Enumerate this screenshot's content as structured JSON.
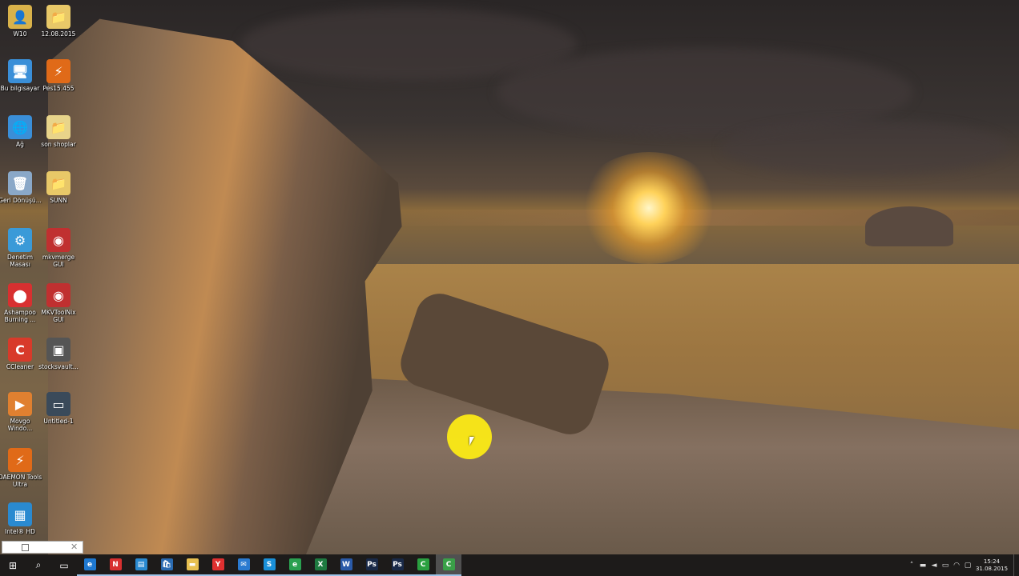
{
  "desktop": {
    "icons": [
      {
        "id": "w10",
        "label": "W10",
        "icon": "user-folder-icon",
        "color": "#d9b24a",
        "glyph": "👤"
      },
      {
        "id": "date-folder",
        "label": "12.08.2015",
        "icon": "folder-icon",
        "color": "#e8c868",
        "glyph": "📁"
      },
      {
        "id": "this-pc",
        "label": "Bu bilgisayar",
        "icon": "computer-icon",
        "color": "#3a8fd8",
        "glyph": "🖥"
      },
      {
        "id": "pes",
        "label": "Pes15.455",
        "icon": "pes-app-icon",
        "color": "#e06a18",
        "glyph": "⚡"
      },
      {
        "id": "network",
        "label": "Ağ",
        "icon": "network-icon",
        "color": "#3a8fd8",
        "glyph": "🌐"
      },
      {
        "id": "son-shoplar",
        "label": "son shoplar",
        "icon": "folder-icon",
        "color": "#e8d48a",
        "glyph": "📁"
      },
      {
        "id": "recycle-bin",
        "label": "Geri Dönüşü...",
        "icon": "recycle-bin-icon",
        "color": "#8aa8c8",
        "glyph": "🗑"
      },
      {
        "id": "sunn",
        "label": "SUNN",
        "icon": "folder-icon",
        "color": "#e8c868",
        "glyph": "📁"
      },
      {
        "id": "control-panel",
        "label": "Denetim Masası",
        "icon": "control-panel-icon",
        "color": "#3a9ad8",
        "glyph": "⚙"
      },
      {
        "id": "mkvmerge",
        "label": "mkvmerge GUI",
        "icon": "mkvmerge-icon",
        "color": "#c03030",
        "glyph": "◉"
      },
      {
        "id": "ashampoo",
        "label": "Ashampoo Burning ...",
        "icon": "ashampoo-icon",
        "color": "#d83030",
        "glyph": "⬤"
      },
      {
        "id": "mkvtoolnix",
        "label": "MKVToolNix GUI",
        "icon": "mkvtoolnix-icon",
        "color": "#c03030",
        "glyph": "◉"
      },
      {
        "id": "ccleaner",
        "label": "CCleaner",
        "icon": "ccleaner-icon",
        "color": "#d83a2a",
        "glyph": "C"
      },
      {
        "id": "stocksvault",
        "label": "stocksvault...",
        "icon": "image-file-icon",
        "color": "#555555",
        "glyph": "▣"
      },
      {
        "id": "movavi",
        "label": "Movgo Windo...",
        "icon": "media-player-icon",
        "color": "#e08030",
        "glyph": "▶"
      },
      {
        "id": "untitled",
        "label": "Untitled-1",
        "icon": "image-file-icon",
        "color": "#3a4a5a",
        "glyph": "▭"
      },
      {
        "id": "daemon",
        "label": "DAEMON Tools Ultra",
        "icon": "daemon-tools-icon",
        "color": "#e06a18",
        "glyph": "⚡"
      },
      {
        "id": "intel-hd",
        "label": "Intel® HD",
        "icon": "intel-graphics-icon",
        "color": "#2a8ad0",
        "glyph": "▦"
      }
    ]
  },
  "taskbar": {
    "items": [
      {
        "id": "start",
        "icon": "windows-start-icon",
        "glyph": "⊞",
        "color": "#1d1b1a"
      },
      {
        "id": "search",
        "icon": "search-icon",
        "glyph": "⌕",
        "color": "#1d1b1a"
      },
      {
        "id": "task-view",
        "icon": "task-view-icon",
        "glyph": "▭",
        "color": "#1d1b1a"
      },
      {
        "id": "edge",
        "icon": "edge-browser-icon",
        "glyph": "e",
        "color": "#1e78d0"
      },
      {
        "id": "app-red",
        "icon": "red-app-icon",
        "glyph": "N",
        "color": "#d83030"
      },
      {
        "id": "app-blue",
        "icon": "blue-app-icon",
        "glyph": "▤",
        "color": "#2a8ad0"
      },
      {
        "id": "store",
        "icon": "store-icon",
        "glyph": "🛍",
        "color": "#2a6ab0"
      },
      {
        "id": "explorer",
        "icon": "file-explorer-icon",
        "glyph": "▬",
        "color": "#e8c050"
      },
      {
        "id": "yandex",
        "icon": "yandex-browser-icon",
        "glyph": "Y",
        "color": "#e03030"
      },
      {
        "id": "mail",
        "icon": "mail-icon",
        "glyph": "✉",
        "color": "#2a7ad0"
      },
      {
        "id": "skype",
        "icon": "skype-icon",
        "glyph": "S",
        "color": "#1a90d8"
      },
      {
        "id": "ie",
        "icon": "internet-explorer-icon",
        "glyph": "e",
        "color": "#2aa050"
      },
      {
        "id": "excel",
        "icon": "excel-icon",
        "glyph": "X",
        "color": "#1e7a40"
      },
      {
        "id": "word",
        "icon": "word-icon",
        "glyph": "W",
        "color": "#2a5aa8"
      },
      {
        "id": "photoshop1",
        "icon": "photoshop-icon",
        "glyph": "Ps",
        "color": "#1a2a48"
      },
      {
        "id": "photoshop2",
        "icon": "photoshop-icon",
        "glyph": "Ps",
        "color": "#1a2a48"
      },
      {
        "id": "camtasia-green",
        "icon": "camtasia-icon",
        "glyph": "C",
        "color": "#2aa040"
      },
      {
        "id": "camtasia-active",
        "icon": "camtasia-recorder-icon",
        "glyph": "C",
        "color": "#3aa048"
      }
    ],
    "tray": {
      "chevron": "˄",
      "clock_time": "15:24",
      "clock_date": "31.08.2015"
    }
  }
}
